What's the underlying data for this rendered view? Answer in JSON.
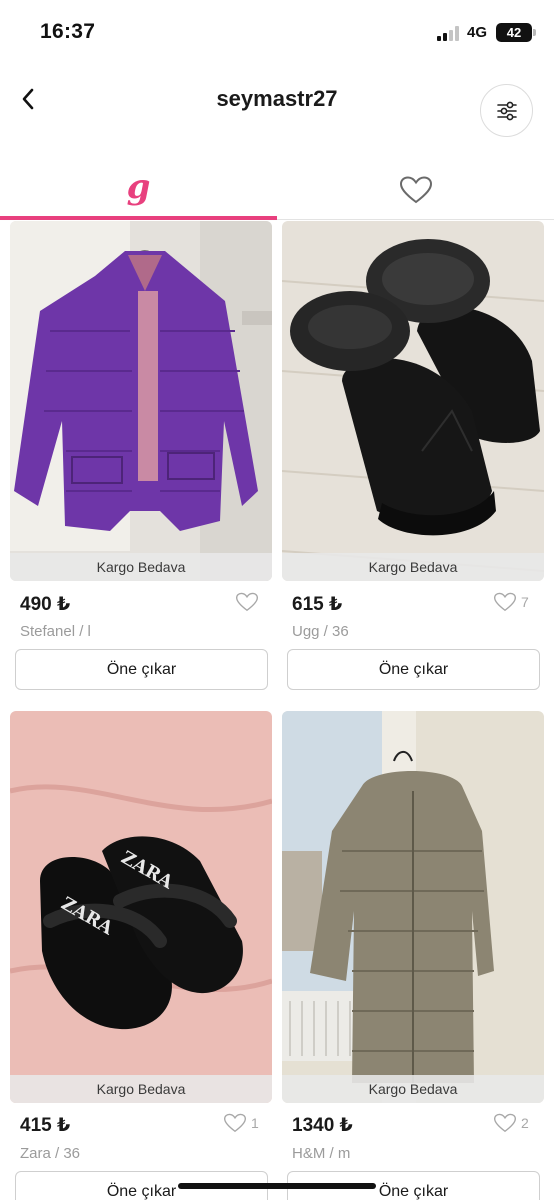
{
  "status_bar": {
    "time": "16:37",
    "network": "4G",
    "battery": "42"
  },
  "header": {
    "title": "seymastr27",
    "back_icon": "chevron-left-icon",
    "filter_icon": "sliders-icon"
  },
  "tabs": [
    {
      "label": "g",
      "icon": "brand-g-icon",
      "active": true
    },
    {
      "label": "",
      "icon": "heart-icon",
      "active": false
    }
  ],
  "colors": {
    "accent": "#e8407e",
    "text": "#1a1a1a",
    "muted": "#9b9b9b"
  },
  "products": [
    {
      "price": "490 ₺",
      "meta": "Stefanel / l",
      "shipping": "Kargo Bedava",
      "likes": "",
      "action": "Öne çıkar"
    },
    {
      "price": "615 ₺",
      "meta": "Ugg / 36",
      "shipping": "Kargo Bedava",
      "likes": "7",
      "action": "Öne çıkar"
    },
    {
      "price": "415 ₺",
      "meta": "Zara / 36",
      "shipping": "Kargo Bedava",
      "likes": "1",
      "action": "Öne çıkar"
    },
    {
      "price": "1340 ₺",
      "meta": "H&M / m",
      "shipping": "Kargo Bedava",
      "likes": "2",
      "action": "Öne çıkar"
    }
  ],
  "image_text": {
    "zara_label": "ZARA"
  }
}
